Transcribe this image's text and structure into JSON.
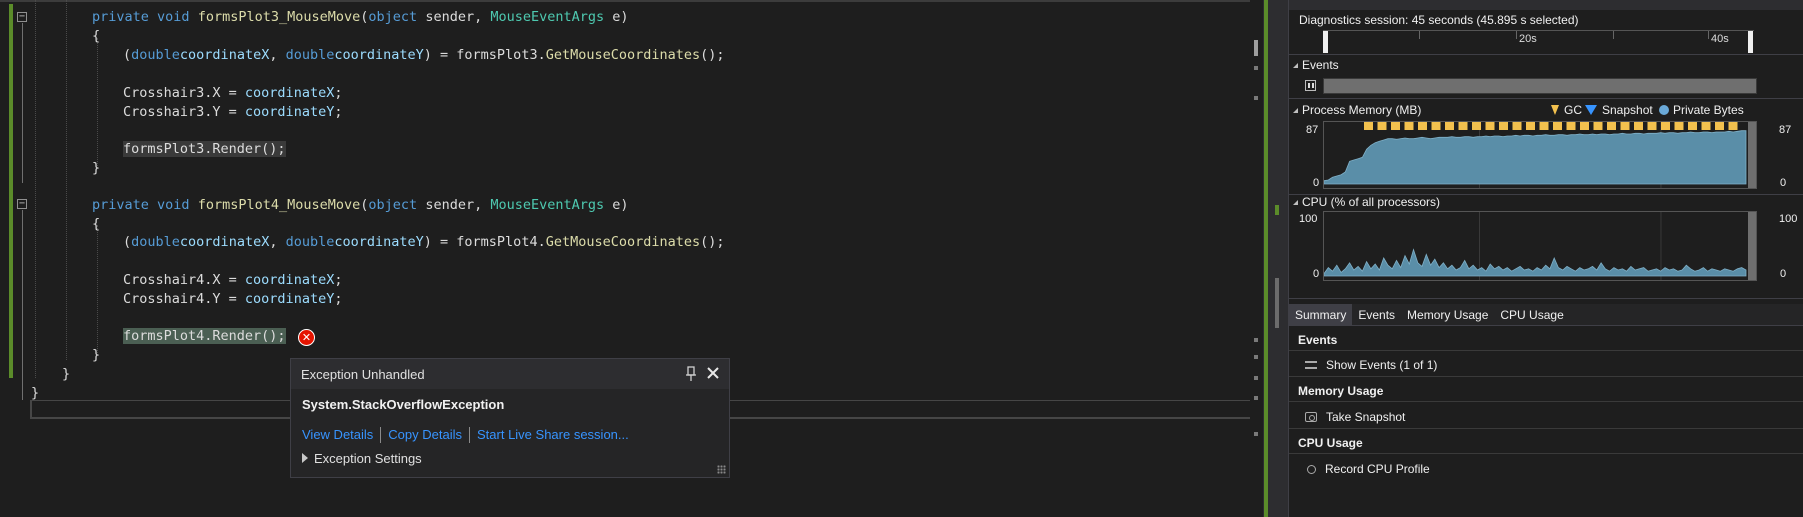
{
  "editor": {
    "lines": [
      {
        "kind": "method1",
        "parts": [
          "private",
          "void",
          "formsPlot3_MouseMove",
          "(",
          "object",
          " sender, ",
          "MouseEventArgs",
          " e)"
        ]
      },
      {
        "kind": "brace",
        "text": "{"
      },
      {
        "kind": "coords",
        "parts": [
          "(",
          "double",
          "coordinateX",
          ", ",
          "double",
          "coordinateY",
          ") = formsPlot3.",
          "GetMouseCoordinates",
          "();"
        ]
      },
      {
        "kind": "assign",
        "parts": [
          "Crosshair3.X = ",
          "coordinateX",
          ";"
        ]
      },
      {
        "kind": "assign",
        "parts": [
          "Crosshair3.Y = ",
          "coordinateY",
          ";"
        ]
      },
      {
        "kind": "render",
        "text": "formsPlot3.Render();"
      },
      {
        "kind": "brace",
        "text": "}"
      },
      {
        "kind": "method2",
        "parts": [
          "private",
          "void",
          "formsPlot4_MouseMove",
          "(",
          "object",
          " sender, ",
          "MouseEventArgs",
          " e)"
        ]
      },
      {
        "kind": "brace",
        "text": "{"
      },
      {
        "kind": "coords",
        "parts": [
          "(",
          "double",
          "coordinateX",
          ", ",
          "double",
          "coordinateY",
          ") = formsPlot4.",
          "GetMouseCoordinates",
          "();"
        ]
      },
      {
        "kind": "assign",
        "parts": [
          "Crosshair4.X = ",
          "coordinateX",
          ";"
        ]
      },
      {
        "kind": "assign",
        "parts": [
          "Crosshair4.Y = ",
          "coordinateY",
          ";"
        ]
      },
      {
        "kind": "render",
        "text": "formsPlot4.Render();"
      },
      {
        "kind": "brace",
        "text": "}"
      },
      {
        "kind": "brace",
        "text": "}"
      },
      {
        "kind": "brace",
        "text": "}"
      }
    ],
    "fold_glyph": "−",
    "error_glyph": "✕"
  },
  "exception_popup": {
    "title": "Exception Unhandled",
    "pin_icon": "pin-icon",
    "close_icon": "close-icon",
    "exception_type": "System.StackOverflowException",
    "links": [
      "View Details",
      "Copy Details",
      "Start Live Share session..."
    ],
    "settings_label": "Exception Settings"
  },
  "diagnostics": {
    "session_label": "Diagnostics session: 45 seconds (45.895 s selected)",
    "ruler_labels": [
      "20s",
      "40s"
    ],
    "sections": {
      "events": "Events",
      "memory": "Process Memory (MB)",
      "cpu": "CPU (% of all processors)"
    },
    "legend": {
      "gc": "GC",
      "snapshot": "Snapshot",
      "private_bytes": "Private Bytes"
    },
    "memory_axis": {
      "top": "87",
      "bottom": "0"
    },
    "cpu_axis": {
      "top": "100",
      "bottom": "0"
    },
    "tabs": [
      "Summary",
      "Events",
      "Memory Usage",
      "CPU Usage"
    ],
    "summary": {
      "events_head": "Events",
      "events_item": "Show Events (1 of 1)",
      "memory_head": "Memory Usage",
      "memory_item": "Take Snapshot",
      "cpu_head": "CPU Usage",
      "cpu_item": "Record CPU Profile"
    },
    "colors": {
      "series": "#5a8ea8",
      "gc": "#f2c14e",
      "snapshot": "#3794ff",
      "private_bytes": "#6aa9d8"
    }
  },
  "chart_data": [
    {
      "type": "area",
      "title": "Process Memory (MB)",
      "ylim": [
        0,
        87
      ],
      "series": [
        {
          "name": "Private Bytes",
          "values": [
            5,
            6,
            10,
            12,
            14,
            18,
            34,
            36,
            38,
            40,
            52,
            58,
            62,
            64,
            66,
            68,
            68,
            67,
            68,
            69,
            68,
            68,
            69,
            70,
            69,
            68,
            69,
            70,
            70,
            70,
            71,
            70,
            70,
            71,
            71,
            70,
            71,
            71,
            72,
            71,
            72,
            72,
            71,
            72,
            72,
            73,
            72,
            73,
            73,
            72,
            73,
            73,
            74,
            73,
            73,
            74,
            74,
            73,
            74,
            74,
            75,
            74,
            74,
            75,
            74,
            75,
            75,
            74,
            75,
            75,
            76,
            75,
            75,
            76,
            76,
            75,
            76,
            76,
            76,
            77,
            76,
            77,
            77,
            76,
            77,
            77,
            78,
            77,
            77,
            78,
            78,
            77,
            78,
            78,
            78,
            79,
            78,
            79,
            80,
            80
          ]
        }
      ]
    },
    {
      "type": "area",
      "title": "CPU (% of all processors)",
      "ylim": [
        0,
        100
      ],
      "series": [
        {
          "name": "CPU",
          "values": [
            4,
            14,
            8,
            18,
            6,
            12,
            22,
            10,
            16,
            8,
            24,
            12,
            20,
            10,
            30,
            18,
            12,
            26,
            14,
            34,
            20,
            44,
            22,
            16,
            36,
            18,
            28,
            14,
            22,
            12,
            18,
            10,
            14,
            26,
            12,
            18,
            10,
            14,
            8,
            20,
            12,
            16,
            10,
            14,
            8,
            12,
            16,
            10,
            12,
            8,
            14,
            10,
            18,
            12,
            30,
            14,
            10,
            16,
            12,
            8,
            14,
            10,
            12,
            16,
            10,
            22,
            12,
            8,
            14,
            10,
            12,
            8,
            16,
            10,
            12,
            14,
            8,
            10,
            12,
            8,
            14,
            10,
            12,
            8,
            10,
            18,
            12,
            8,
            10,
            14,
            8,
            12,
            10,
            8,
            12,
            10,
            8,
            12,
            14,
            10
          ]
        }
      ]
    }
  ]
}
